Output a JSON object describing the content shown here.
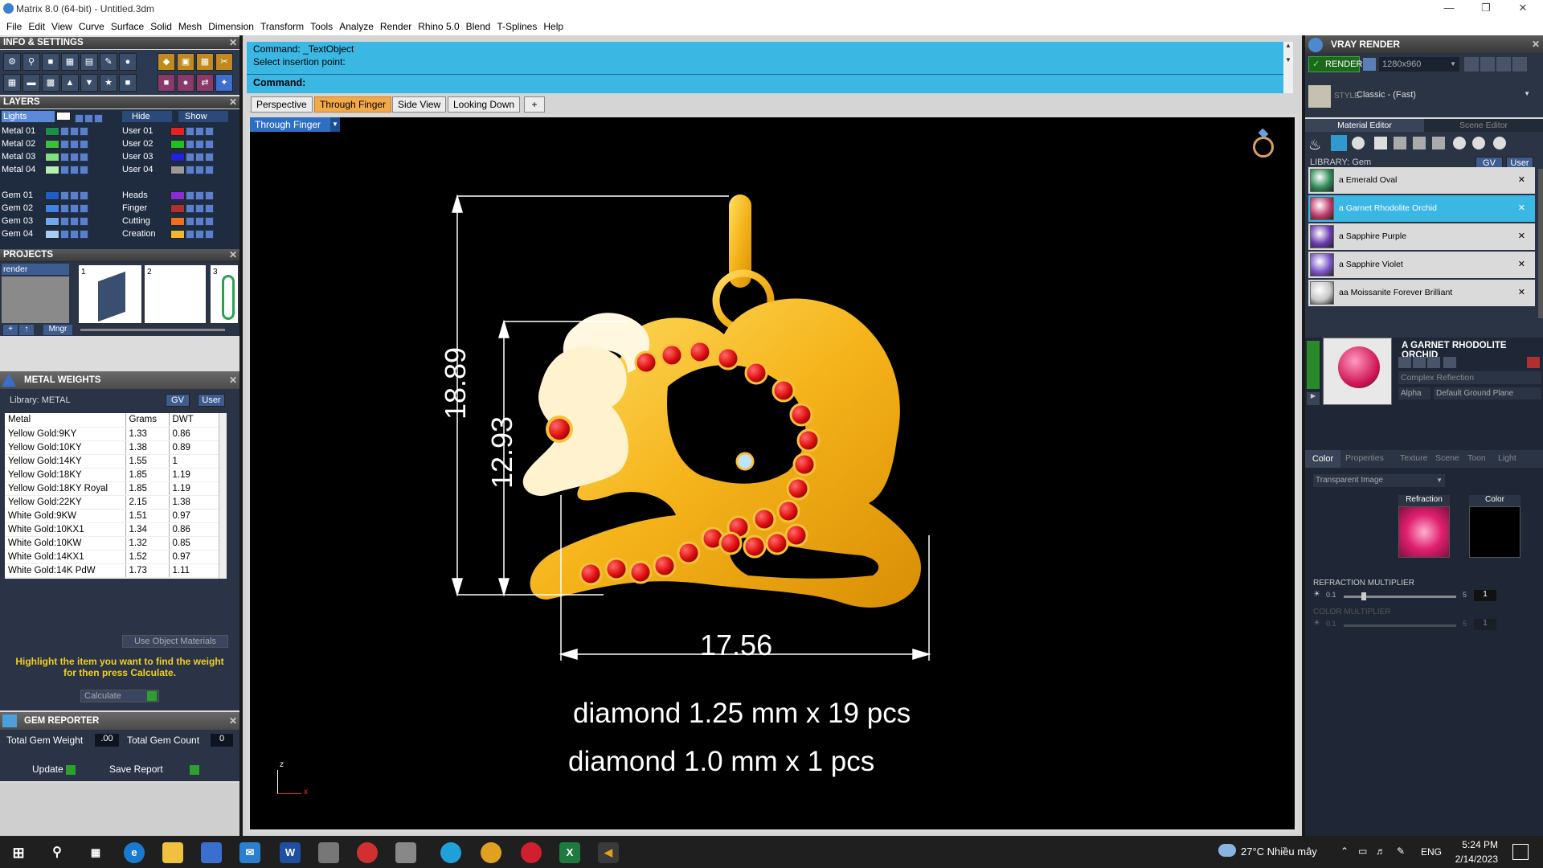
{
  "window": {
    "title": "Matrix 8.0 (64-bit) - Untitled.3dm"
  },
  "menu": [
    "File",
    "Edit",
    "View",
    "Curve",
    "Surface",
    "Solid",
    "Mesh",
    "Dimension",
    "Transform",
    "Tools",
    "Analyze",
    "Render",
    "Rhino 5.0",
    "Blend",
    "T-Splines",
    "Help"
  ],
  "info_settings": {
    "title": "INFO & SETTINGS"
  },
  "layers": {
    "title": "LAYERS",
    "lights": "Lights",
    "hide": "Hide",
    "show": "Show",
    "left": [
      {
        "name": "Metal 01",
        "color": "#1a8f4a"
      },
      {
        "name": "Metal 02",
        "color": "#3fbf3f"
      },
      {
        "name": "Metal 03",
        "color": "#7fe07f"
      },
      {
        "name": "Metal 04",
        "color": "#b4f0b4"
      },
      {
        "name": "Gem 01",
        "color": "#1e5fc7"
      },
      {
        "name": "Gem 02",
        "color": "#3d86e8"
      },
      {
        "name": "Gem 03",
        "color": "#6fa9f0"
      },
      {
        "name": "Gem 04",
        "color": "#a9cbf7"
      }
    ],
    "right": [
      {
        "name": "User 01",
        "color": "#e82020"
      },
      {
        "name": "User 02",
        "color": "#20c020"
      },
      {
        "name": "User 03",
        "color": "#2020e8"
      },
      {
        "name": "User 04",
        "color": "#9a9a9a"
      },
      {
        "name": "Heads",
        "color": "#8a2bd6"
      },
      {
        "name": "Finger",
        "color": "#b03030"
      },
      {
        "name": "Cutting",
        "color": "#f07020"
      },
      {
        "name": "Creation",
        "color": "#f0b830"
      }
    ]
  },
  "projects": {
    "title": "PROJECTS",
    "item": "render",
    "thumbs": [
      "1",
      "2",
      "3"
    ],
    "mngr": "Mngr"
  },
  "metal_weights": {
    "title": "METAL WEIGHTS",
    "library": "Library: METAL",
    "gv": "GV",
    "user": "User",
    "headers": [
      "Metal",
      "Grams",
      "DWT"
    ],
    "rows": [
      [
        "Yellow Gold:9KY",
        "1.33",
        "0.86"
      ],
      [
        "Yellow Gold:10KY",
        "1.38",
        "0.89"
      ],
      [
        "Yellow Gold:14KY",
        "1.55",
        "1"
      ],
      [
        "Yellow Gold:18KY",
        "1.85",
        "1.19"
      ],
      [
        "Yellow Gold:18KY Royal",
        "1.85",
        "1.19"
      ],
      [
        "Yellow Gold:22KY",
        "2.15",
        "1.38"
      ],
      [
        "White Gold:9KW",
        "1.51",
        "0.97"
      ],
      [
        "White Gold:10KX1",
        "1.34",
        "0.86"
      ],
      [
        "White Gold:10KW",
        "1.32",
        "0.85"
      ],
      [
        "White Gold:14KX1",
        "1.52",
        "0.97"
      ],
      [
        "White Gold:14K PdW",
        "1.73",
        "1.11"
      ]
    ],
    "use_object_materials": "Use Object Materials",
    "hint": "Highlight the item you want to find the weight for then press Calculate.",
    "calculate": "Calculate"
  },
  "gem_reporter": {
    "title": "GEM REPORTER",
    "total_weight_label": "Total Gem Weight",
    "total_weight": ".00",
    "total_count_label": "Total Gem Count",
    "total_count": "0",
    "update": "Update",
    "save": "Save Report"
  },
  "command": {
    "line1": "Command: _TextObject",
    "line2": "Select insertion point:",
    "prompt": "Command:"
  },
  "viewport": {
    "tabs": [
      "Perspective",
      "Through Finger",
      "Side View",
      "Looking Down",
      "+"
    ],
    "active_tab": "Through Finger",
    "label": "Through Finger",
    "dim_height": "18.89",
    "dim_inner": "12.93",
    "dim_width": "17.56",
    "text1": "diamond 1.25 mm x 19 pcs",
    "text2": "diamond 1.0 mm x 1 pcs",
    "axis_z": "z",
    "axis_x": "x"
  },
  "vray": {
    "title": "VRAY RENDER",
    "render": "RENDER",
    "resolution": "1280x960",
    "style_label": "STYLE:",
    "style": "Classic - (Fast)",
    "tab_material": "Material Editor",
    "tab_scene": "Scene Editor",
    "library": "LIBRARY: Gem",
    "gv": "GV",
    "user": "User",
    "gems": [
      {
        "name": "a Emerald Oval",
        "color": "#2e8b57"
      },
      {
        "name": "a Garnet Rhodolite Orchid",
        "color": "#c23a6a"
      },
      {
        "name": "a Sapphire Purple",
        "color": "#6a3bb0"
      },
      {
        "name": "a Sapphire Violet",
        "color": "#7a55c8"
      },
      {
        "name": "aa Moissanite Forever Brilliant",
        "color": "#c8c8c8"
      }
    ],
    "selected_gem": "a Garnet Rhodolite Orchid",
    "preview_title": "A GARNET RHODOLITE ORCHID",
    "reflection": "Complex Reflection",
    "alpha": "Alpha",
    "ground": "Default Ground Plane",
    "subtabs": [
      "Color",
      "Properties",
      "Texture",
      "Scene",
      "Toon",
      "Light"
    ],
    "transparent": "Transparent Image",
    "refraction": "Refraction",
    "color": "Color",
    "refraction_multiplier": "REFRACTION MULTIPLIER",
    "color_multiplier": "COLOR MULTIPLIER",
    "min": "0.1",
    "max": "5",
    "value": "1"
  },
  "taskbar": {
    "weather": "27°C  Nhiều mây",
    "lang": "ENG",
    "time": "5:24 PM",
    "date": "2/14/2023"
  }
}
